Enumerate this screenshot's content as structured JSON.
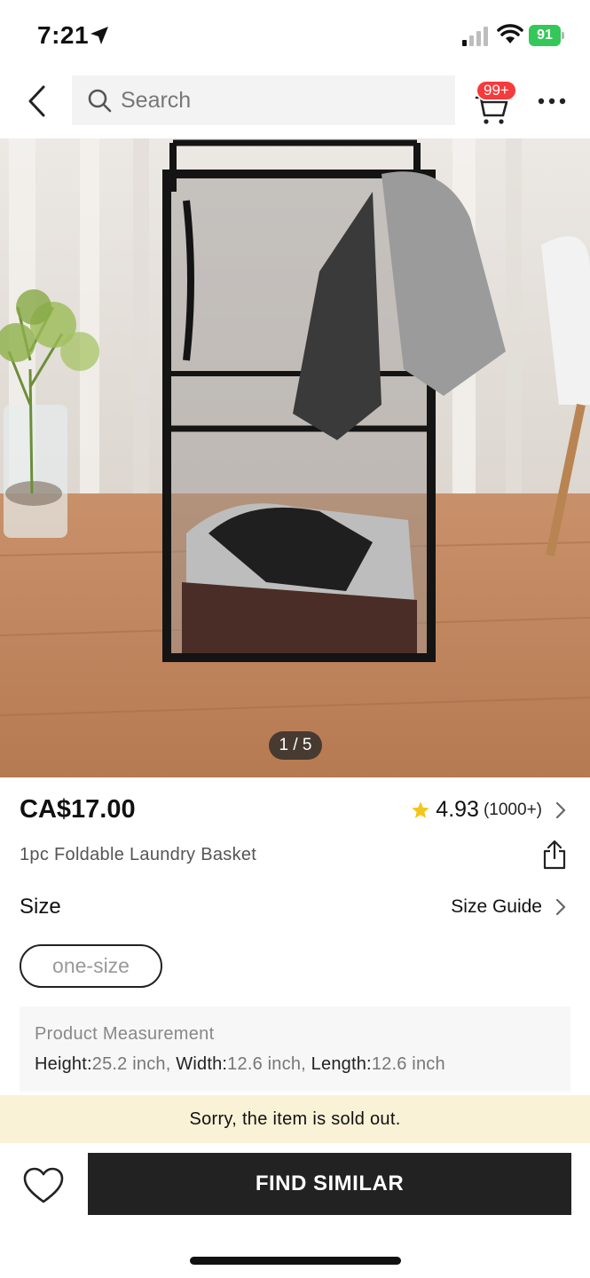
{
  "status_bar": {
    "time": "7:21",
    "battery": "91"
  },
  "nav": {
    "search_placeholder": "Search",
    "cart_badge": "99+"
  },
  "gallery": {
    "page_indicator": "1 / 5"
  },
  "product": {
    "price": "CA$17.00",
    "rating": "4.93",
    "rating_count": "(1000+)",
    "title": "1pc Foldable Laundry Basket"
  },
  "size": {
    "label": "Size",
    "guide_label": "Size Guide",
    "option": "one-size"
  },
  "measurement": {
    "title": "Product Measurement",
    "height_key": "Height:",
    "height_val": "25.2 inch,",
    "width_key": "Width:",
    "width_val": "12.6 inch,",
    "length_key": "Length:",
    "length_val": "12.6 inch"
  },
  "notice": {
    "sold_out": "Sorry, the item is sold out."
  },
  "actions": {
    "find_similar": "FIND SIMILAR"
  },
  "colors": {
    "sold_out_bg": "#faf2d7",
    "badge": "#f53b3b",
    "battery": "#34c759",
    "star": "#f5c518",
    "button": "#222222"
  }
}
